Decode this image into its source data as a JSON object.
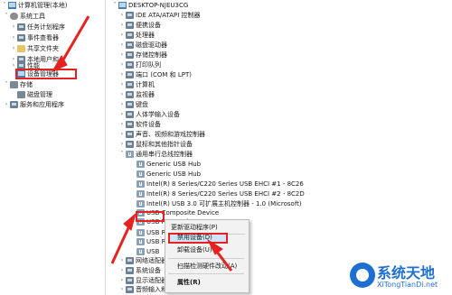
{
  "left_tree": [
    {
      "label": "计算机管理(本地)",
      "caret": "˅",
      "icon": "computer-management-icon"
    },
    {
      "label": "系统工具",
      "caret": "˅",
      "icon": "tools-icon"
    },
    {
      "label": "任务计划程序",
      "caret": "›",
      "icon": "clock-icon"
    },
    {
      "label": "事件查看器",
      "caret": "›",
      "icon": "event-icon"
    },
    {
      "label": "共享文件夹",
      "caret": "›",
      "icon": "folder-icon"
    },
    {
      "label": "本地用户和",
      "caret": "›",
      "icon": "users-icon"
    },
    {
      "label": "性能",
      "caret": "›",
      "icon": "performance-icon"
    },
    {
      "label": "设备管理器",
      "caret": "",
      "icon": "device-manager-icon"
    },
    {
      "label": "存储",
      "caret": "˅",
      "icon": "storage-icon"
    },
    {
      "label": "磁盘管理",
      "caret": "",
      "icon": "disk-icon"
    },
    {
      "label": "服务和应用程序",
      "caret": "›",
      "icon": "services-icon"
    }
  ],
  "device_tree": {
    "root": "DESKTOP-NJEU3CG",
    "items": [
      {
        "label": "IDE ATA/ATAPI 控制器",
        "caret": "›",
        "icon": "controller-icon"
      },
      {
        "label": "便携设备",
        "caret": "›",
        "icon": "device-icon"
      },
      {
        "label": "处理器",
        "caret": "›",
        "icon": "cpu-icon"
      },
      {
        "label": "磁盘驱动器",
        "caret": "›",
        "icon": "disk-icon"
      },
      {
        "label": "存储控制器",
        "caret": "›",
        "icon": "controller-icon"
      },
      {
        "label": "打印队列",
        "caret": "›",
        "icon": "printer-icon"
      },
      {
        "label": "端口 (COM 和 LPT)",
        "caret": "›",
        "icon": "port-icon"
      },
      {
        "label": "计算机",
        "caret": "›",
        "icon": "computer-icon"
      },
      {
        "label": "监视器",
        "caret": "›",
        "icon": "monitor-icon"
      },
      {
        "label": "键盘",
        "caret": "›",
        "icon": "keyboard-icon"
      },
      {
        "label": "人体学输入设备",
        "caret": "›",
        "icon": "hid-icon"
      },
      {
        "label": "软件设备",
        "caret": "›",
        "icon": "software-device-icon"
      },
      {
        "label": "声音、视频和游戏控制器",
        "caret": "›",
        "icon": "audio-icon"
      },
      {
        "label": "鼠标和其他指针设备",
        "caret": "›",
        "icon": "mouse-icon"
      },
      {
        "label": "通用串行总线控制器",
        "caret": "˅",
        "icon": "usb-icon"
      }
    ],
    "usb_children": [
      "Generic USB Hub",
      "Generic USB Hub",
      "Intel(R) 8 Series/C220 Series USB EHCI #1 - 8C26",
      "Intel(R) 8 Series/C220 Series USB EHCI #2 - 8C2D",
      "Intel(R) USB 3.0 可扩展主机控制器 - 1.0 (Microsoft)",
      "USB Composite Device",
      "USB Root Hub",
      "USB R",
      "USB R",
      "USB"
    ],
    "bottom_items": [
      {
        "label": "网络适配器",
        "caret": "›",
        "icon": "network-icon"
      },
      {
        "label": "系统设备",
        "caret": "›",
        "icon": "system-icon"
      },
      {
        "label": "显示适配器",
        "caret": "›",
        "icon": "display-icon"
      },
      {
        "label": "音频输入和输出",
        "caret": "›",
        "icon": "audio-icon"
      }
    ]
  },
  "context_menu": {
    "items": [
      "更新驱动程序(P)",
      "禁用设备(D)",
      "卸载设备(U)",
      "扫描检测硬件改动(A)",
      "属性(R)"
    ]
  },
  "watermark": {
    "title": "系统天地",
    "url": "XiTongTianDi.net"
  },
  "colors": {
    "highlight_red": "#e52222",
    "watermark_blue": "#1f6fd2",
    "selection": "#cfe4f8"
  }
}
